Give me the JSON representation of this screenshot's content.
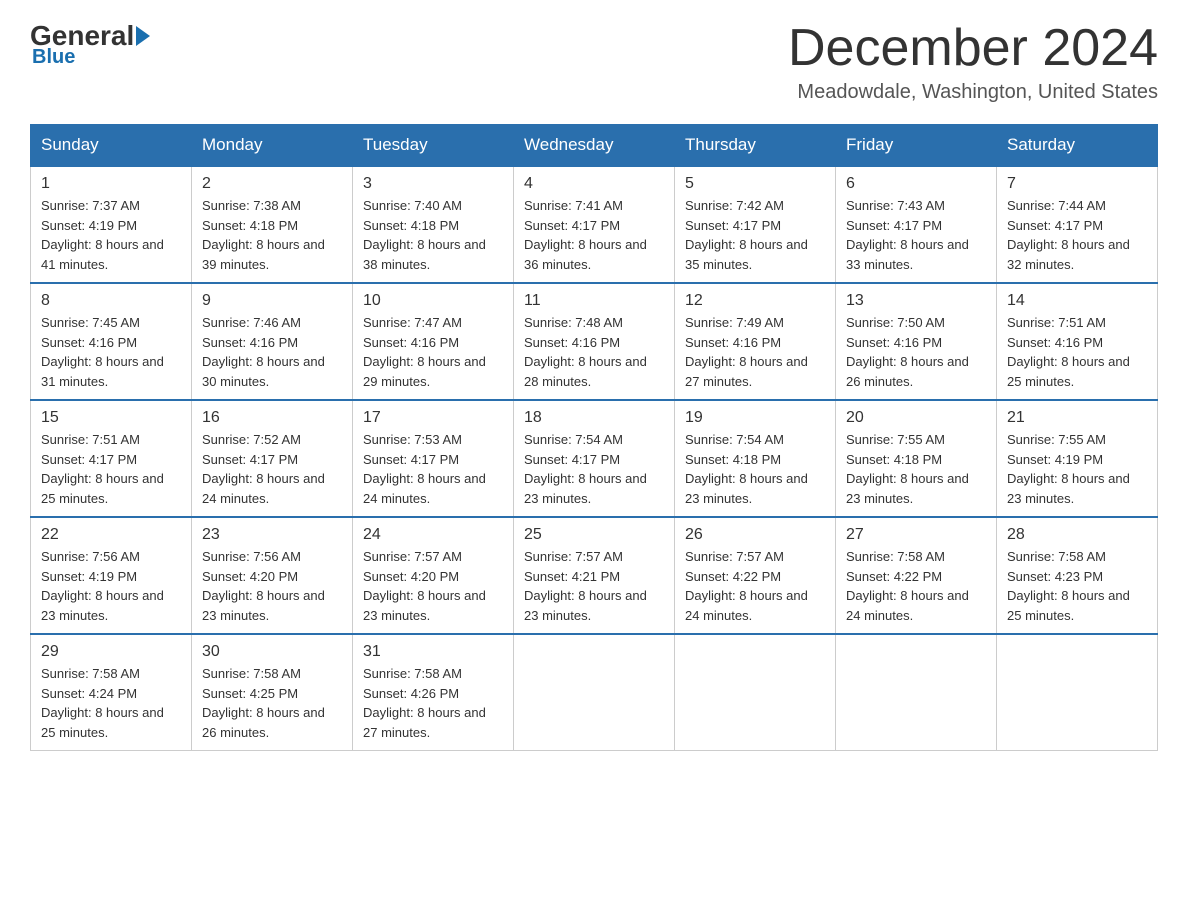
{
  "header": {
    "logo_general": "General",
    "logo_blue": "Blue",
    "month_title": "December 2024",
    "location": "Meadowdale, Washington, United States"
  },
  "days_of_week": [
    "Sunday",
    "Monday",
    "Tuesday",
    "Wednesday",
    "Thursday",
    "Friday",
    "Saturday"
  ],
  "weeks": [
    [
      {
        "day": "1",
        "sunrise": "7:37 AM",
        "sunset": "4:19 PM",
        "daylight": "8 hours and 41 minutes."
      },
      {
        "day": "2",
        "sunrise": "7:38 AM",
        "sunset": "4:18 PM",
        "daylight": "8 hours and 39 minutes."
      },
      {
        "day": "3",
        "sunrise": "7:40 AM",
        "sunset": "4:18 PM",
        "daylight": "8 hours and 38 minutes."
      },
      {
        "day": "4",
        "sunrise": "7:41 AM",
        "sunset": "4:17 PM",
        "daylight": "8 hours and 36 minutes."
      },
      {
        "day": "5",
        "sunrise": "7:42 AM",
        "sunset": "4:17 PM",
        "daylight": "8 hours and 35 minutes."
      },
      {
        "day": "6",
        "sunrise": "7:43 AM",
        "sunset": "4:17 PM",
        "daylight": "8 hours and 33 minutes."
      },
      {
        "day": "7",
        "sunrise": "7:44 AM",
        "sunset": "4:17 PM",
        "daylight": "8 hours and 32 minutes."
      }
    ],
    [
      {
        "day": "8",
        "sunrise": "7:45 AM",
        "sunset": "4:16 PM",
        "daylight": "8 hours and 31 minutes."
      },
      {
        "day": "9",
        "sunrise": "7:46 AM",
        "sunset": "4:16 PM",
        "daylight": "8 hours and 30 minutes."
      },
      {
        "day": "10",
        "sunrise": "7:47 AM",
        "sunset": "4:16 PM",
        "daylight": "8 hours and 29 minutes."
      },
      {
        "day": "11",
        "sunrise": "7:48 AM",
        "sunset": "4:16 PM",
        "daylight": "8 hours and 28 minutes."
      },
      {
        "day": "12",
        "sunrise": "7:49 AM",
        "sunset": "4:16 PM",
        "daylight": "8 hours and 27 minutes."
      },
      {
        "day": "13",
        "sunrise": "7:50 AM",
        "sunset": "4:16 PM",
        "daylight": "8 hours and 26 minutes."
      },
      {
        "day": "14",
        "sunrise": "7:51 AM",
        "sunset": "4:16 PM",
        "daylight": "8 hours and 25 minutes."
      }
    ],
    [
      {
        "day": "15",
        "sunrise": "7:51 AM",
        "sunset": "4:17 PM",
        "daylight": "8 hours and 25 minutes."
      },
      {
        "day": "16",
        "sunrise": "7:52 AM",
        "sunset": "4:17 PM",
        "daylight": "8 hours and 24 minutes."
      },
      {
        "day": "17",
        "sunrise": "7:53 AM",
        "sunset": "4:17 PM",
        "daylight": "8 hours and 24 minutes."
      },
      {
        "day": "18",
        "sunrise": "7:54 AM",
        "sunset": "4:17 PM",
        "daylight": "8 hours and 23 minutes."
      },
      {
        "day": "19",
        "sunrise": "7:54 AM",
        "sunset": "4:18 PM",
        "daylight": "8 hours and 23 minutes."
      },
      {
        "day": "20",
        "sunrise": "7:55 AM",
        "sunset": "4:18 PM",
        "daylight": "8 hours and 23 minutes."
      },
      {
        "day": "21",
        "sunrise": "7:55 AM",
        "sunset": "4:19 PM",
        "daylight": "8 hours and 23 minutes."
      }
    ],
    [
      {
        "day": "22",
        "sunrise": "7:56 AM",
        "sunset": "4:19 PM",
        "daylight": "8 hours and 23 minutes."
      },
      {
        "day": "23",
        "sunrise": "7:56 AM",
        "sunset": "4:20 PM",
        "daylight": "8 hours and 23 minutes."
      },
      {
        "day": "24",
        "sunrise": "7:57 AM",
        "sunset": "4:20 PM",
        "daylight": "8 hours and 23 minutes."
      },
      {
        "day": "25",
        "sunrise": "7:57 AM",
        "sunset": "4:21 PM",
        "daylight": "8 hours and 23 minutes."
      },
      {
        "day": "26",
        "sunrise": "7:57 AM",
        "sunset": "4:22 PM",
        "daylight": "8 hours and 24 minutes."
      },
      {
        "day": "27",
        "sunrise": "7:58 AM",
        "sunset": "4:22 PM",
        "daylight": "8 hours and 24 minutes."
      },
      {
        "day": "28",
        "sunrise": "7:58 AM",
        "sunset": "4:23 PM",
        "daylight": "8 hours and 25 minutes."
      }
    ],
    [
      {
        "day": "29",
        "sunrise": "7:58 AM",
        "sunset": "4:24 PM",
        "daylight": "8 hours and 25 minutes."
      },
      {
        "day": "30",
        "sunrise": "7:58 AM",
        "sunset": "4:25 PM",
        "daylight": "8 hours and 26 minutes."
      },
      {
        "day": "31",
        "sunrise": "7:58 AM",
        "sunset": "4:26 PM",
        "daylight": "8 hours and 27 minutes."
      },
      null,
      null,
      null,
      null
    ]
  ]
}
